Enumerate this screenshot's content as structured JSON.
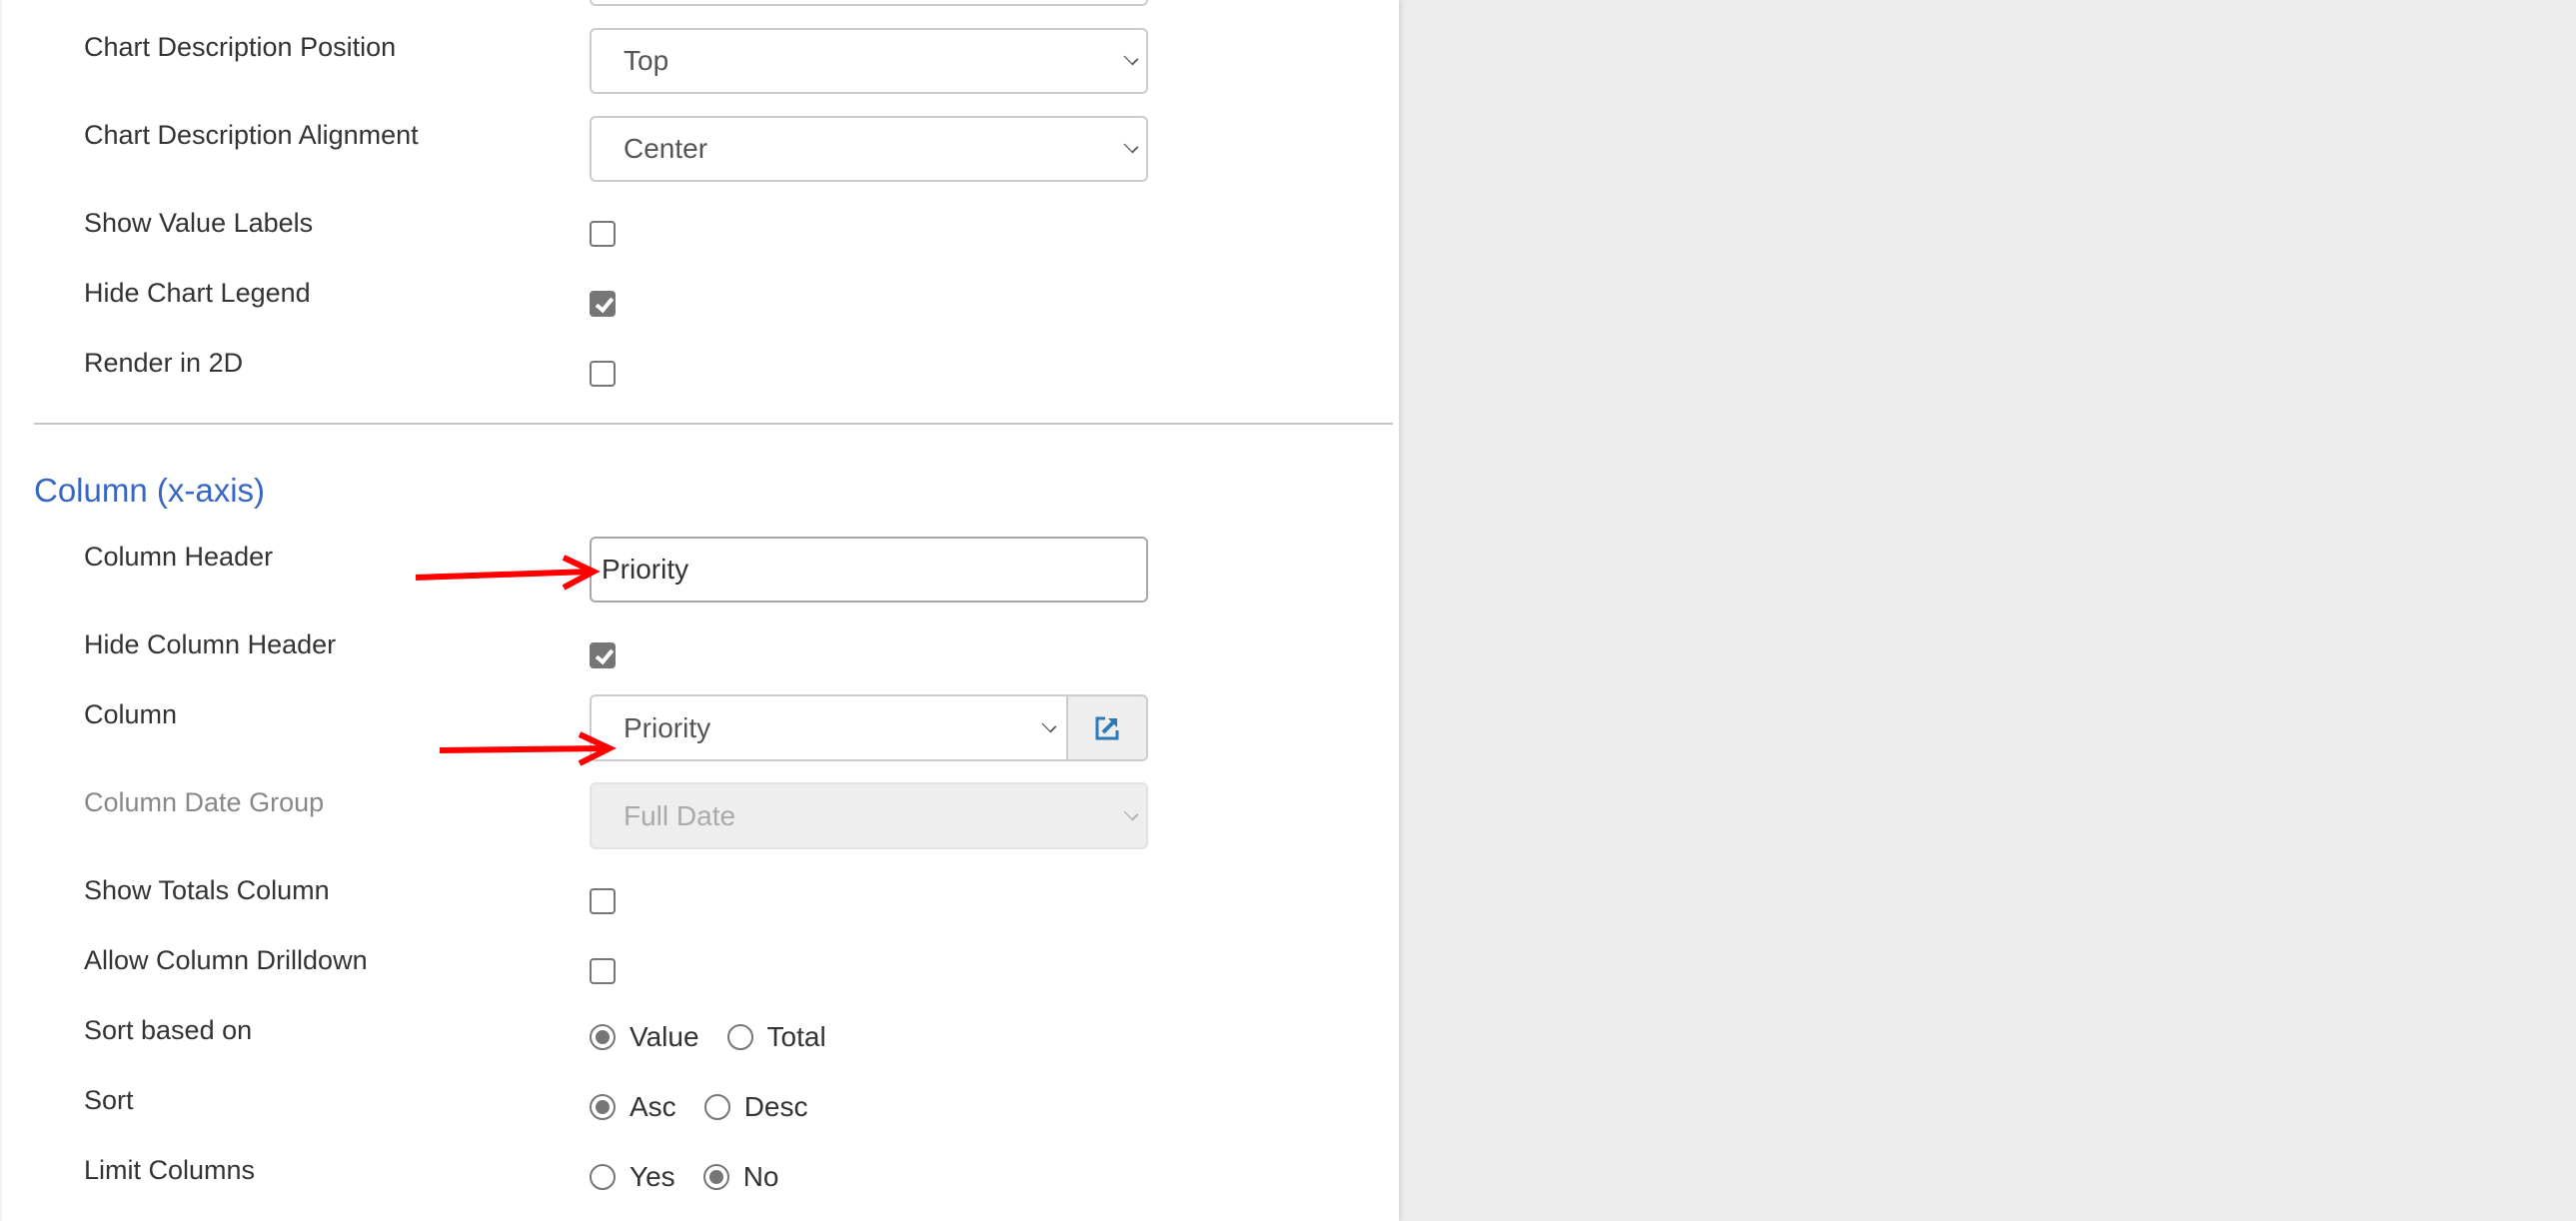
{
  "colors": {
    "accent": "#3866c4",
    "annotation_arrow": "#ff0000",
    "link_icon": "#2a7ab9",
    "background": "#ececec"
  },
  "chart_settings": {
    "description_position": {
      "label": "Chart Description Position",
      "value": "Top"
    },
    "description_alignment": {
      "label": "Chart Description Alignment",
      "value": "Center"
    },
    "show_value_labels": {
      "label": "Show Value Labels",
      "checked": false
    },
    "hide_chart_legend": {
      "label": "Hide Chart Legend",
      "checked": true
    },
    "render_2d": {
      "label": "Render in 2D",
      "checked": false
    }
  },
  "column_section": {
    "heading": "Column (x-axis)",
    "column_header": {
      "label": "Column Header",
      "value": "Priority"
    },
    "hide_column_header": {
      "label": "Hide Column Header",
      "checked": true
    },
    "column": {
      "label": "Column",
      "value": "Priority",
      "link_icon": "external-link-icon"
    },
    "column_date_group": {
      "label": "Column Date Group",
      "value": "Full Date",
      "disabled": true
    },
    "show_totals_column": {
      "label": "Show Totals Column",
      "checked": false
    },
    "allow_column_drilldown": {
      "label": "Allow Column Drilldown",
      "checked": false
    },
    "sort_based_on": {
      "label": "Sort based on",
      "options": [
        "Value",
        "Total"
      ],
      "selected": "Value"
    },
    "sort": {
      "label": "Sort",
      "options": [
        "Asc",
        "Desc"
      ],
      "selected": "Asc"
    },
    "limit_columns": {
      "label": "Limit Columns",
      "options": [
        "Yes",
        "No"
      ],
      "selected": "No"
    }
  }
}
